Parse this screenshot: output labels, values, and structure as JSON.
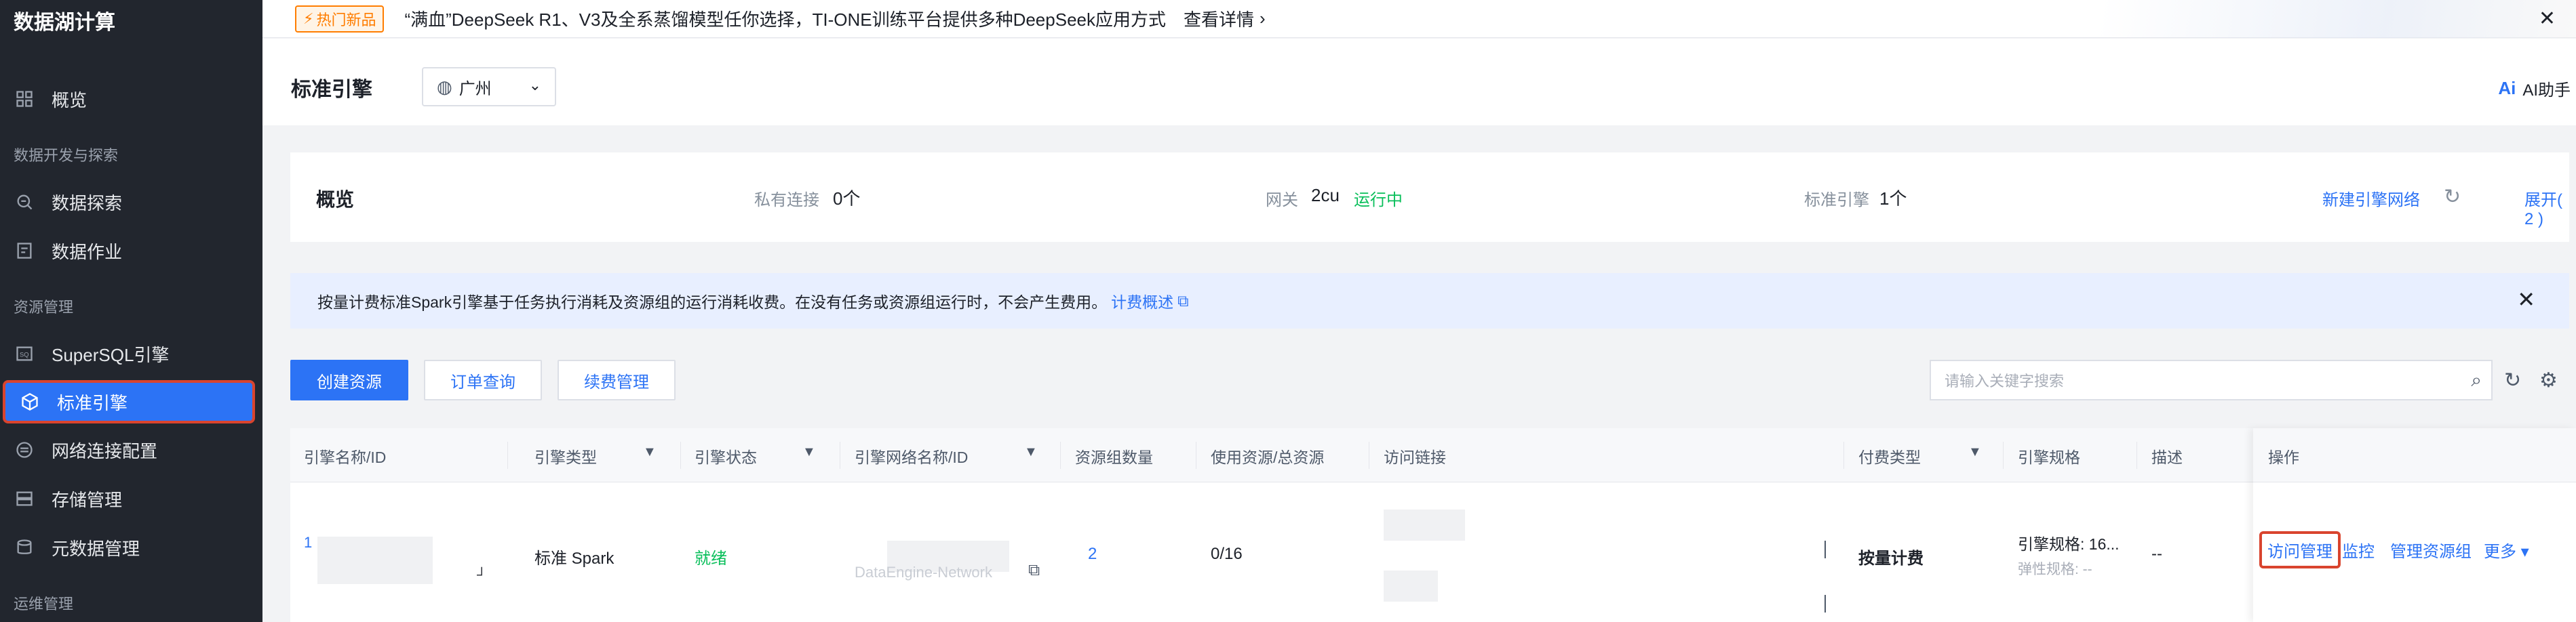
{
  "sidebar": {
    "title": "数据湖计算",
    "groups": {
      "dev": "数据开发与探索",
      "resource": "资源管理",
      "ops": "运维管理"
    },
    "items": [
      {
        "label": "概览",
        "icon": "grid-icon"
      },
      {
        "label": "数据探索",
        "icon": "search-data-icon"
      },
      {
        "label": "数据作业",
        "icon": "job-icon"
      },
      {
        "label": "SuperSQL引擎",
        "icon": "sql-icon"
      },
      {
        "label": "标准引擎",
        "icon": "cube-icon"
      },
      {
        "label": "网络连接配置",
        "icon": "network-icon"
      },
      {
        "label": "存储管理",
        "icon": "storage-icon"
      },
      {
        "label": "元数据管理",
        "icon": "metadata-icon"
      }
    ]
  },
  "banner": {
    "tag": "热门新品",
    "text": "“满血”DeepSeek R1、V3及全系蒸馏模型任你选择，TI-ONE训练平台提供多种DeepSeek应用方式",
    "link": "查看详情"
  },
  "header": {
    "title": "标准引擎",
    "region": "广州",
    "ai_helper": "AI助手"
  },
  "overview": {
    "title": "概览",
    "private_link_label": "私有连接",
    "private_link_value": "0个",
    "gateway_label": "网关",
    "gateway_value": "2cu",
    "gateway_status": "运行中",
    "engine_label": "标准引擎",
    "engine_value": "1个",
    "new_network": "新建引擎网络",
    "expand": "展开( 2 )"
  },
  "alert": {
    "text": "按量计费标准Spark引擎基于任务执行消耗及资源组的运行消耗收费。在没有任务或资源组运行时，不会产生费用。",
    "link": "计费概述"
  },
  "toolbar": {
    "create": "创建资源",
    "orders": "订单查询",
    "renew": "续费管理",
    "search_placeholder": "请输入关键字搜索"
  },
  "table": {
    "headers": {
      "name": "引擎名称/ID",
      "type": "引擎类型",
      "status": "引擎状态",
      "network": "引擎网络名称/ID",
      "rg_count": "资源组数量",
      "usage": "使用资源/总资源",
      "access": "访问链接",
      "billing": "付费类型",
      "spec": "引擎规格",
      "desc": "描述",
      "ops": "操作"
    },
    "row": {
      "name_prefix": "1",
      "type": "标准 Spark",
      "status": "就绪",
      "network_partial": "DataEngine-Network",
      "rg_count": "2",
      "usage": "0/16",
      "billing": "按量计费",
      "spec": "引擎规格: 16...",
      "elastic": "弹性规格: --",
      "desc": "--",
      "ops": {
        "access": "访问管理",
        "monitor": "监控",
        "rg": "管理资源组",
        "more": "更多"
      }
    }
  },
  "colors": {
    "primary": "#2c73f5",
    "success": "#0abf5b",
    "highlight": "#d9442e",
    "sidebar_bg": "#22262e"
  }
}
